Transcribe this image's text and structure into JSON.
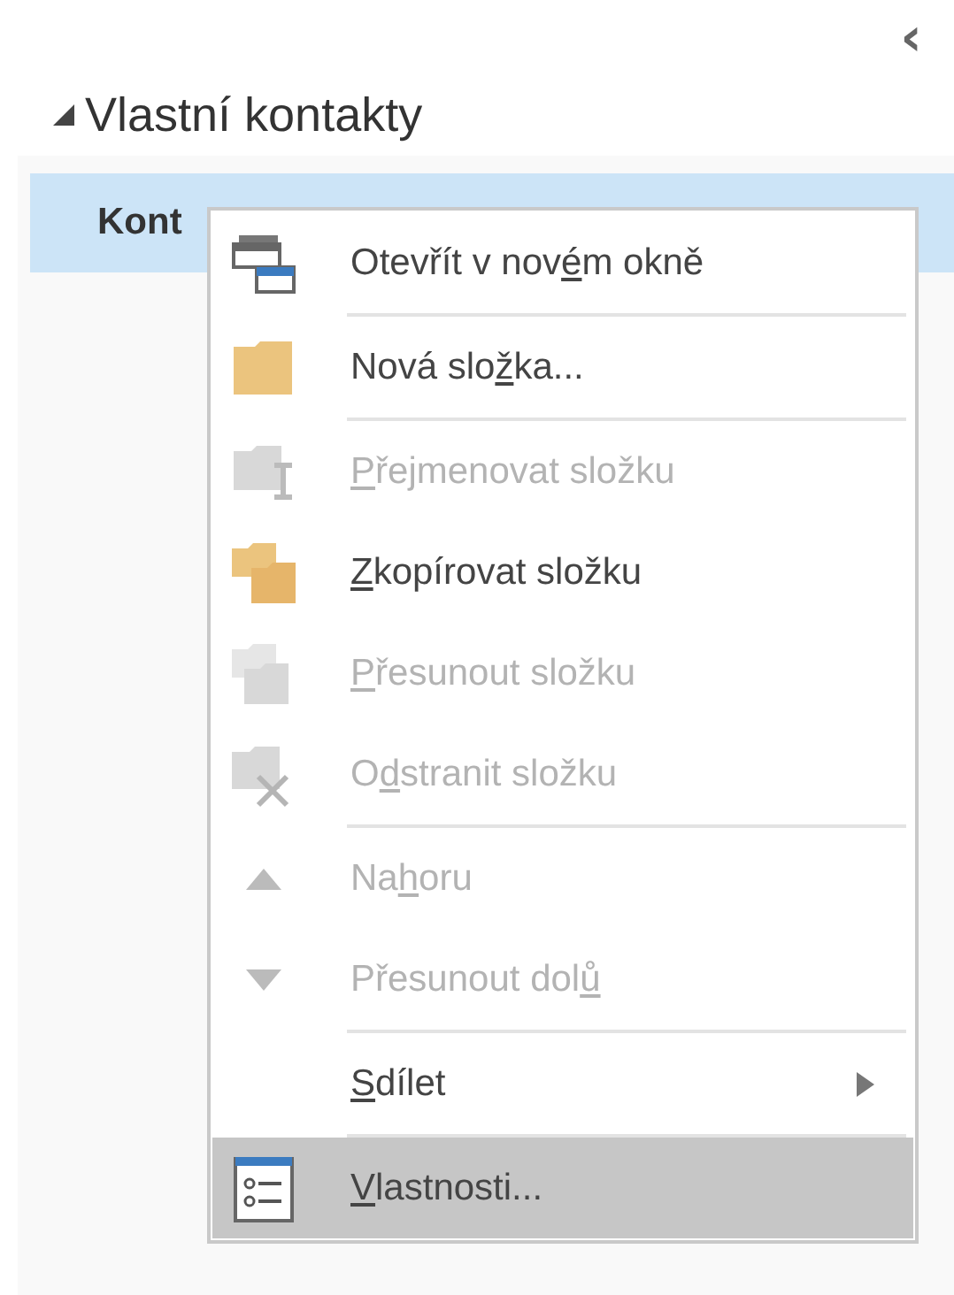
{
  "pane": {
    "collapse_glyph": "‹"
  },
  "group": {
    "label": "Vlastní kontakty",
    "expanded": true
  },
  "folder": {
    "label": "Kont",
    "selected": true
  },
  "context_menu": {
    "groups": [
      [
        {
          "kind": "command",
          "label_before": "Otevřít v nov",
          "access_key": "é",
          "label_after": "m okně",
          "disabled": false,
          "selected": false
        }
      ],
      [
        {
          "kind": "command",
          "label_before": "Nová slo",
          "access_key": "ž",
          "label_after": "ka...",
          "disabled": false,
          "selected": false
        }
      ],
      [
        {
          "kind": "command",
          "access_key": "P",
          "label_after": "řejmenovat složku",
          "disabled": true,
          "selected": false
        },
        {
          "kind": "command",
          "access_key": "Z",
          "label_after": "kopírovat složku",
          "disabled": false,
          "selected": false
        },
        {
          "kind": "command",
          "access_key": "P",
          "label_after": "řesunout složku",
          "disabled": true,
          "selected": false
        },
        {
          "kind": "command",
          "label_before": "O",
          "access_key": "d",
          "label_after": "stranit složku",
          "disabled": true,
          "selected": false
        }
      ],
      [
        {
          "kind": "command",
          "label_before": "Na",
          "access_key": "h",
          "label_after": "oru",
          "disabled": true,
          "selected": false
        },
        {
          "kind": "command",
          "label_before": "Přesunout dol",
          "access_key": "ů",
          "disabled": true,
          "selected": false
        }
      ],
      [
        {
          "kind": "submenu",
          "access_key": "S",
          "label_after": "dílet",
          "disabled": false,
          "selected": false
        }
      ],
      [
        {
          "kind": "command",
          "access_key": "V",
          "label_after": "lastnosti...",
          "disabled": false,
          "selected": true
        }
      ]
    ]
  }
}
